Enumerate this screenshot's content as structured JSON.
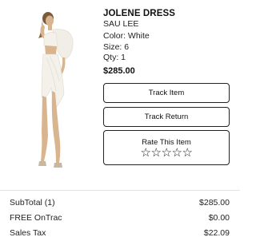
{
  "product": {
    "name": "JOLENE DRESS",
    "brand": "SAU LEE",
    "color": "Color: White",
    "size": "Size: 6",
    "qty": "Qty: 1",
    "price": "$285.00"
  },
  "actions": {
    "track_item": "Track Item",
    "track_return": "Track Return",
    "rate_label": "Rate This Item",
    "stars": [
      "☆",
      "☆",
      "☆",
      "☆",
      "☆"
    ]
  },
  "summary": {
    "rows": [
      {
        "label": "SubTotal (1)",
        "value": "$285.00"
      },
      {
        "label": "FREE OnTrac",
        "value": "$0.00"
      },
      {
        "label": "Sales Tax",
        "value": "$22.09"
      }
    ]
  },
  "icons": {
    "star": "star-outline-icon"
  },
  "colors": {
    "text": "#111111",
    "border": "#222222",
    "background": "#ffffff"
  }
}
